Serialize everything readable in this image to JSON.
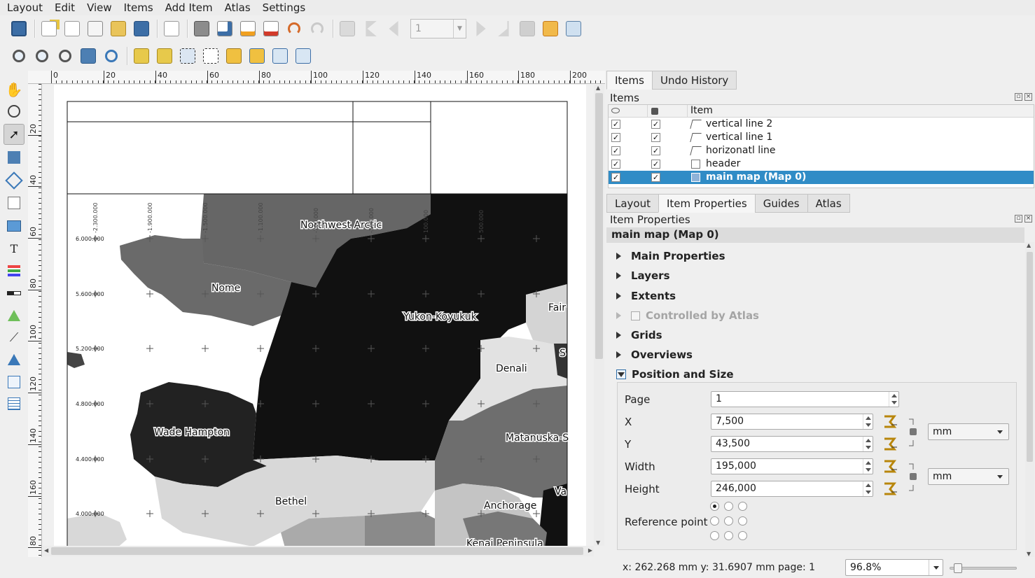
{
  "menu": [
    "Layout",
    "Edit",
    "View",
    "Items",
    "Add Item",
    "Atlas",
    "Settings"
  ],
  "toolbar": {
    "page_number": "1"
  },
  "ruler": {
    "h_labels": [
      "0",
      "20",
      "40",
      "60",
      "80",
      "100",
      "120",
      "140",
      "160",
      "180",
      "200"
    ],
    "v_labels": [
      "20",
      "40",
      "60",
      "80",
      "100",
      "120",
      "140",
      "160",
      "80"
    ]
  },
  "map": {
    "regions": [
      "Northwest Arctic",
      "Nome",
      "Yukon-Koyukuk",
      "Fair",
      "Denali",
      "S",
      "Wade Hampton",
      "Matanuska-S",
      "Bethel",
      "Anchorage",
      "Va",
      "Kenai Peninsula"
    ],
    "y_grid_labels": [
      "6.000.000",
      "5.600.000",
      "5.200.000",
      "4.800.000",
      "4.400.000",
      "4.000.000"
    ],
    "x_grid_labels": [
      "-2.300.000",
      "-1.900.000",
      "-1.500.000",
      "-1.100.000",
      "-700.000",
      "-300.000",
      "100.000",
      "500.000"
    ]
  },
  "items_panel": {
    "tabs": [
      "Items",
      "Undo History"
    ],
    "title": "Items",
    "column_item": "Item",
    "rows": [
      {
        "name": "vertical line 2",
        "visible": true,
        "locked": true,
        "selected": false
      },
      {
        "name": "vertical line 1",
        "visible": true,
        "locked": true,
        "selected": false
      },
      {
        "name": "horizonatl line",
        "visible": true,
        "locked": true,
        "selected": false
      },
      {
        "name": "header",
        "visible": true,
        "locked": true,
        "selected": false
      },
      {
        "name": "main map (Map 0)",
        "visible": true,
        "locked": true,
        "selected": true
      }
    ]
  },
  "props_panel": {
    "tabs": [
      "Layout",
      "Item Properties",
      "Guides",
      "Atlas"
    ],
    "title": "Item Properties",
    "subtitle": "main map (Map 0)",
    "groups": [
      "Main Properties",
      "Layers",
      "Extents",
      "Controlled by Atlas",
      "Grids",
      "Overviews",
      "Position and Size"
    ],
    "position": {
      "page_label": "Page",
      "page_value": "1",
      "x_label": "X",
      "x_value": "7,500",
      "y_label": "Y",
      "y_value": "43,500",
      "width_label": "Width",
      "width_value": "195,000",
      "height_label": "Height",
      "height_value": "246,000",
      "unit_pos": "mm",
      "unit_size": "mm",
      "ref_label": "Reference point"
    }
  },
  "status": {
    "coords": "x: 262.268 mm  y: 31.6907 mm  page: 1",
    "zoom": "96.8%"
  },
  "colors": {
    "selection": "#308cc6",
    "map_dark": "#111111"
  }
}
